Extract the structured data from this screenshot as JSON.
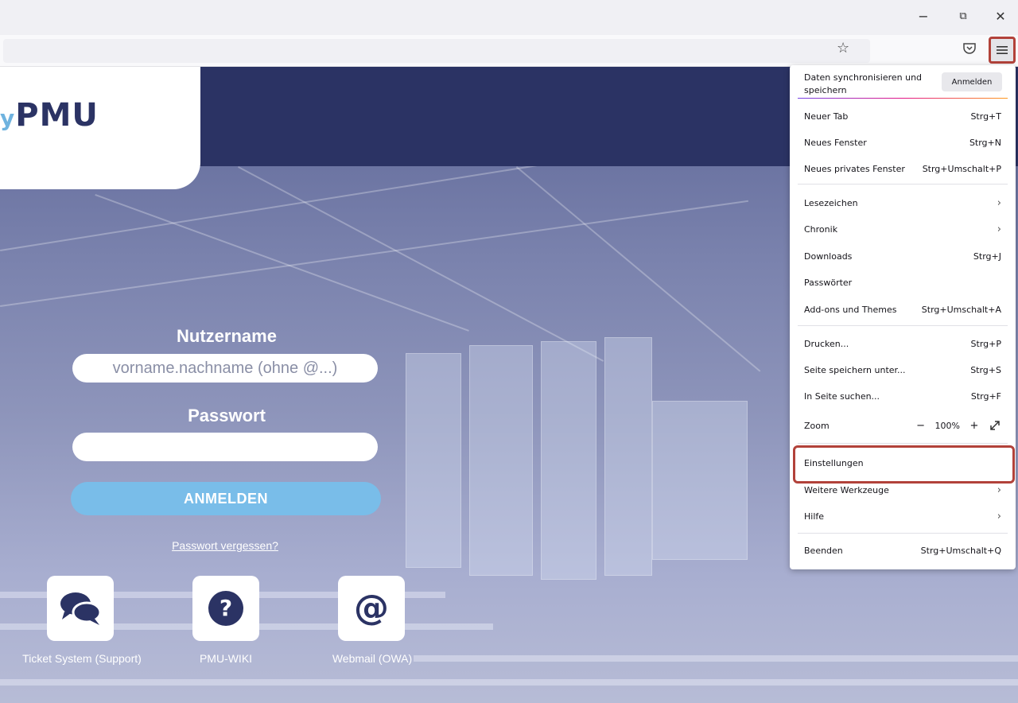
{
  "browser": {
    "window_controls": {
      "minimize": "−",
      "restore": "🗗",
      "close": "✕"
    },
    "icons": {
      "bookmark": "star-icon",
      "pocket": "pocket-icon",
      "menu": "hamburger-menu-icon"
    }
  },
  "page": {
    "logo": {
      "prefix": "y",
      "text": "PMU"
    },
    "login": {
      "username_label": "Nutzername",
      "username_placeholder": "vorname.nachname (ohne @...)",
      "password_label": "Passwort",
      "password_value": "",
      "submit_label": "ANMELDEN",
      "forgot_link": "Passwort vergessen?"
    },
    "quick_links": [
      {
        "label": "Ticket System (Support)",
        "icon": "chat-bubbles-icon"
      },
      {
        "label": "PMU-WIKI",
        "icon": "question-icon"
      },
      {
        "label": "Webmail (OWA)",
        "icon": "at-icon"
      }
    ],
    "colors": {
      "header": "#2b3364",
      "button": "#79bde9"
    }
  },
  "menu": {
    "sync_text": "Daten synchronisieren und speichern",
    "sync_button": "Anmelden",
    "items": [
      {
        "label": "Neuer Tab",
        "shortcut": "Strg+T"
      },
      {
        "label": "Neues Fenster",
        "shortcut": "Strg+N"
      },
      {
        "label": "Neues privates Fenster",
        "shortcut": "Strg+Umschalt+P"
      },
      {
        "label": "Lesezeichen",
        "shortcut": "›"
      },
      {
        "label": "Chronik",
        "shortcut": "›"
      },
      {
        "label": "Downloads",
        "shortcut": "Strg+J"
      },
      {
        "label": "Passwörter",
        "shortcut": ""
      },
      {
        "label": "Add-ons und Themes",
        "shortcut": "Strg+Umschalt+A"
      },
      {
        "label": "Drucken...",
        "shortcut": "Strg+P"
      },
      {
        "label": "Seite speichern unter...",
        "shortcut": "Strg+S"
      },
      {
        "label": "In Seite suchen...",
        "shortcut": "Strg+F"
      },
      {
        "label": "Einstellungen",
        "shortcut": ""
      },
      {
        "label": "Weitere Werkzeuge",
        "shortcut": "›"
      },
      {
        "label": "Hilfe",
        "shortcut": "›"
      },
      {
        "label": "Beenden",
        "shortcut": "Strg+Umschalt+Q"
      }
    ],
    "zoom": {
      "label": "Zoom",
      "minus": "−",
      "value": "100%",
      "plus": "+"
    }
  }
}
